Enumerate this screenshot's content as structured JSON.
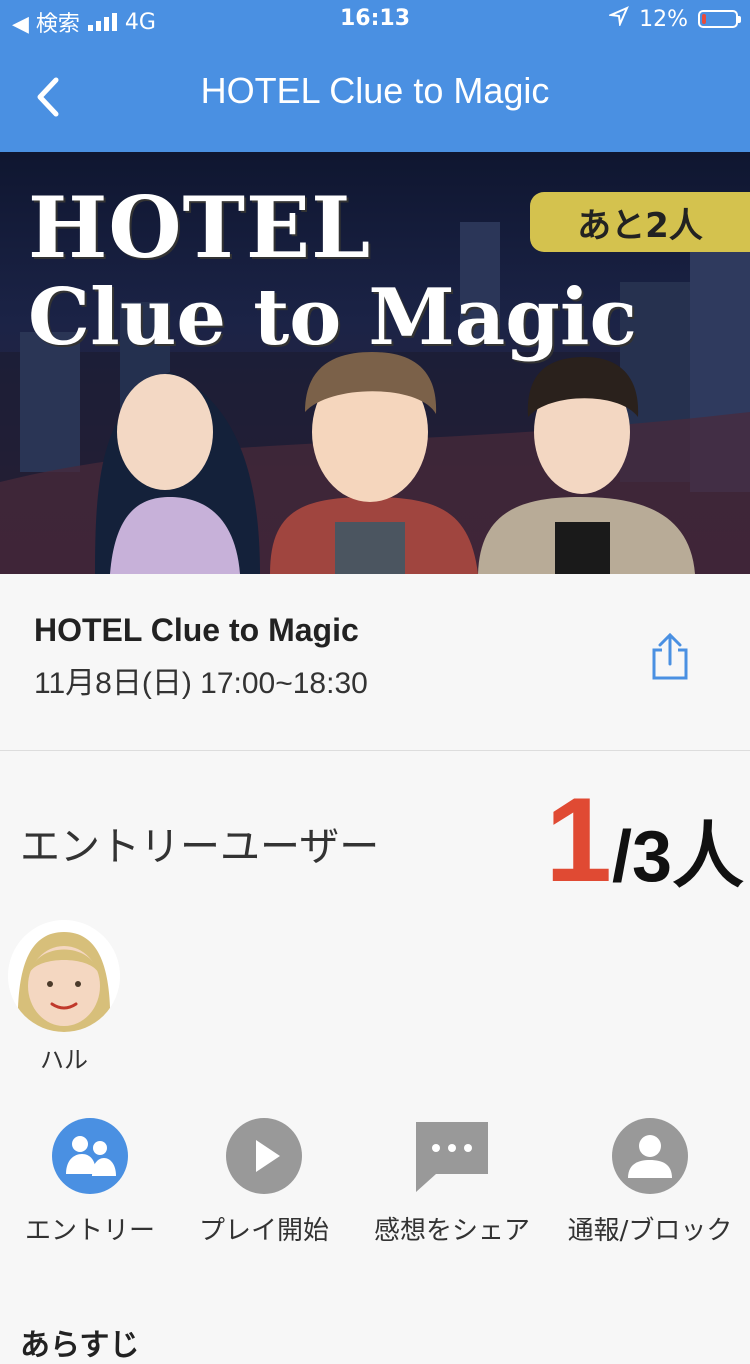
{
  "status_bar": {
    "back_app": "◀ 検索",
    "network": "4G",
    "time": "16:13",
    "battery": "12%"
  },
  "nav": {
    "title": "HOTEL Clue to Magic"
  },
  "hero": {
    "title_line1": "HOTEL",
    "title_line2": "Clue to Magic",
    "remaining_badge": "あと2人"
  },
  "event": {
    "name": "HOTEL Clue to Magic",
    "datetime": "11月8日(日) 17:00~18:30"
  },
  "entry": {
    "label": "エントリーユーザー",
    "current": "1",
    "max_text": "/3人"
  },
  "users": [
    {
      "name": "ハル"
    }
  ],
  "actions": [
    {
      "label": "エントリー",
      "icon": "group-icon",
      "color": "#4a90e2"
    },
    {
      "label": "プレイ開始",
      "icon": "play-icon",
      "color": "#999999"
    },
    {
      "label": "感想をシェア",
      "icon": "chat-icon",
      "color": "#999999"
    },
    {
      "label": "通報/ブロック",
      "icon": "person-icon",
      "color": "#999999"
    }
  ],
  "partial_heading": "あらすじ"
}
